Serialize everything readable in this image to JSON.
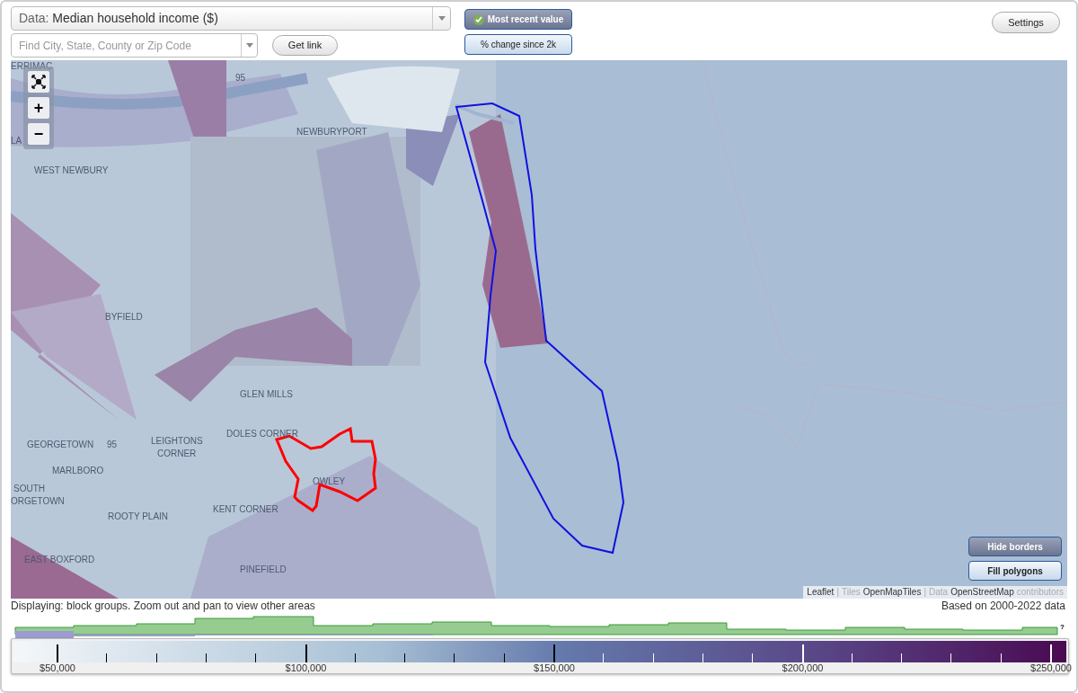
{
  "data_select": {
    "prefix": "Data:",
    "value": "Median household income ($)"
  },
  "search": {
    "placeholder": "Find City, State, County or Zip Code"
  },
  "get_link": "Get link",
  "value_modes": [
    {
      "label": "Most recent value",
      "selected": true
    },
    {
      "label": "% change since 2k",
      "selected": false
    }
  ],
  "settings": "Settings",
  "map": {
    "labels": [
      {
        "text": "ERRIMAC"
      },
      {
        "text": "95"
      },
      {
        "text": "NEWBURYPORT"
      },
      {
        "text": "LA"
      },
      {
        "text": "WEST NEWBURY"
      },
      {
        "text": "BYFIELD"
      },
      {
        "text": "GLEN MILLS"
      },
      {
        "text": "GEORGETOWN"
      },
      {
        "text": "95"
      },
      {
        "text": "LEIGHTONS"
      },
      {
        "text": "CORNER"
      },
      {
        "text": "DOLES CORNER"
      },
      {
        "text": "MARLBORO"
      },
      {
        "text": "SOUTH"
      },
      {
        "text": "ORGETOWN"
      },
      {
        "text": "OWLEY"
      },
      {
        "text": "ROOTY PLAIN"
      },
      {
        "text": "KENT CORNER"
      },
      {
        "text": "EAST BOXFORD"
      },
      {
        "text": "PINEFIELD"
      }
    ],
    "zoom_controls": [
      "+",
      "−"
    ],
    "layer_buttons": [
      {
        "label": "Hide borders",
        "selected": true
      },
      {
        "label": "Fill polygons",
        "selected": false
      }
    ],
    "attribution": [
      {
        "text": "Leaflet",
        "kind": "link"
      },
      {
        "text": "|",
        "kind": "plain"
      },
      {
        "text": "Tiles",
        "kind": "plain"
      },
      {
        "text": "OpenMapTiles",
        "kind": "link"
      },
      {
        "text": "|",
        "kind": "plain"
      },
      {
        "text": "Data",
        "kind": "plain"
      },
      {
        "text": "OpenStreetMap",
        "kind": "link"
      },
      {
        "text": "contributors",
        "kind": "plain"
      }
    ]
  },
  "status": {
    "displaying": "Displaying: block groups. Zoom out and pan to view other areas",
    "based_on": "Based on 2000-2022 data"
  },
  "histogram_marker": "?",
  "legend": {
    "labels": [
      "$50,000",
      "$100,000",
      "$150,000",
      "$200,000",
      "$250,000"
    ]
  }
}
